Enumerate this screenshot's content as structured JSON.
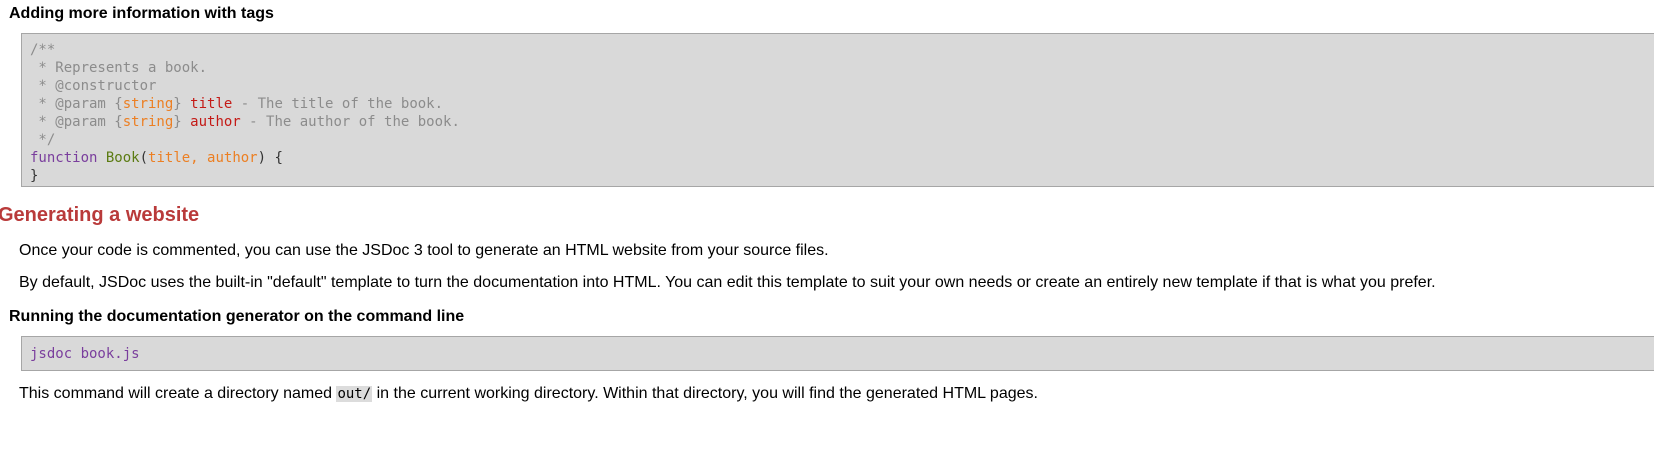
{
  "sections": {
    "tags_heading": "Adding more information with tags",
    "code_sample": {
      "comment_open": "/**",
      "line_represents": " * Represents a book.",
      "line_constructor": " * @constructor",
      "param1_prefix": " * @param {",
      "param1_type": "string",
      "param1_close": "} ",
      "param1_name": "title",
      "param1_desc": " - The title of the book.",
      "param2_prefix": " * @param {",
      "param2_type": "string",
      "param2_close": "} ",
      "param2_name": "author",
      "param2_desc": " - The author of the book.",
      "comment_close": " */",
      "keyword_function": "function",
      "function_name": "Book",
      "paren_open": "(",
      "params": "title, author",
      "paren_close_brace": ") {",
      "brace_close": "}"
    },
    "website_heading": "Generating a website",
    "para1": "Once your code is commented, you can use the JSDoc 3 tool to generate an HTML website from your source files.",
    "para2": "By default, JSDoc uses the built-in \"default\" template to turn the documentation into HTML. You can edit this template to suit your own needs or create an entirely new template if that is what you prefer.",
    "cmdline_heading": "Running the documentation generator on the command line",
    "command": "jsdoc book.js",
    "para3_before": "This command will create a directory named ",
    "para3_code": "out/",
    "para3_after": " in the current working directory. Within that directory, you will find the generated HTML pages."
  },
  "colors": {
    "heading_red": "#b93a3a",
    "code_bg": "#d9d9d9",
    "comment": "#8c8c8c",
    "type": "#ec7f23",
    "name": "#c41a16",
    "keyword": "#7a3e9d",
    "function": "#5b7b12"
  }
}
